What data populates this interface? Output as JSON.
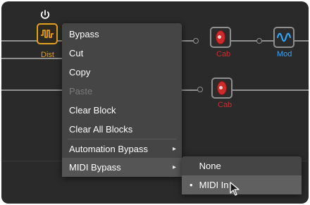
{
  "signal_chain": {
    "power_icon": "power-icon",
    "blocks": [
      {
        "id": "dist",
        "label": "Dist",
        "label_color": "#e6a11c",
        "icon": "waveform-icon",
        "color": "#e6a11c"
      },
      {
        "id": "cab-top",
        "label": "Cab",
        "label_color": "#cf2b2b",
        "icon": "speaker-icon",
        "color": "#cf2b2b"
      },
      {
        "id": "mod",
        "label": "Mod",
        "label_color": "#32a7ff",
        "icon": "wave-icon",
        "color": "#32a7ff"
      },
      {
        "id": "cab-bottom",
        "label": "Cab",
        "label_color": "#cf2b2b",
        "icon": "speaker-icon",
        "color": "#cf2b2b"
      }
    ]
  },
  "context_menu": {
    "items": [
      {
        "label": "Bypass",
        "enabled": true
      },
      {
        "label": "Cut",
        "enabled": true
      },
      {
        "label": "Copy",
        "enabled": true
      },
      {
        "label": "Paste",
        "enabled": false
      },
      {
        "label": "Clear Block",
        "enabled": true
      },
      {
        "label": "Clear All Blocks",
        "enabled": true
      },
      {
        "label": "Automation Bypass",
        "enabled": true,
        "has_submenu": true,
        "arrow": "▸"
      },
      {
        "label": "MIDI Bypass",
        "enabled": true,
        "has_submenu": true,
        "arrow": "▸",
        "active": true
      }
    ]
  },
  "midi_bypass_submenu": {
    "items": [
      {
        "label": "None",
        "selected": false
      },
      {
        "label": "MIDI In",
        "selected": true,
        "bullet": "•"
      }
    ]
  },
  "colors": {
    "background": "#2a2a2a",
    "menu": "#454545",
    "submenu_hover": "#606060",
    "accent_dist": "#e6a11c",
    "accent_cab": "#cf2b2b",
    "accent_mod": "#32a7ff"
  }
}
